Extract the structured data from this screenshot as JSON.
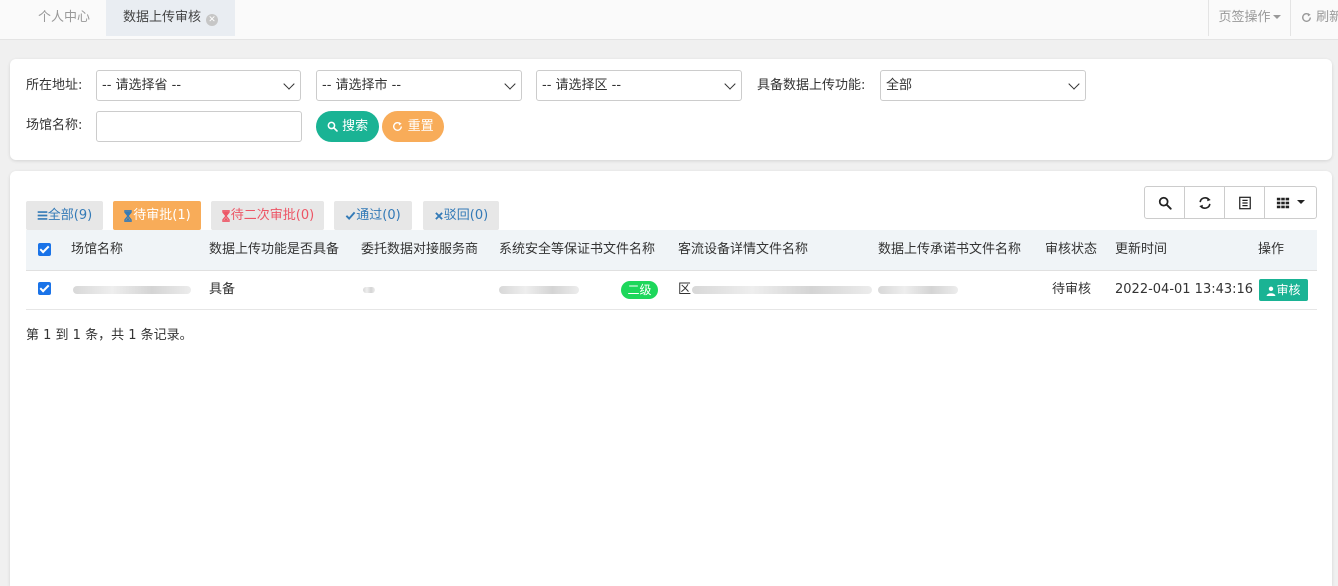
{
  "tabs": [
    {
      "label": "个人中心"
    },
    {
      "label": "数据上传审核",
      "close": "⊗"
    }
  ],
  "topbar": {
    "page_ops": "页签操作",
    "refresh": "刷新"
  },
  "search": {
    "address_label": "所在地址:",
    "province": "-- 请选择省 --",
    "city": "-- 请选择市 --",
    "district": "-- 请选择区 --",
    "upload_label": "具备数据上传功能:",
    "upload_value": "全部",
    "venue_label": "场馆名称:",
    "venue_value": "",
    "search_btn": "搜索",
    "reset_btn": "重置"
  },
  "status_tabs": [
    {
      "label": "全部(9)",
      "icon": "list-icon"
    },
    {
      "label": "待审批(1)",
      "icon": "hourglass-icon"
    },
    {
      "label": "待二次审批(0)",
      "icon": "hourglass-icon"
    },
    {
      "label": "通过(0)",
      "icon": "check-icon"
    },
    {
      "label": "驳回(0)",
      "icon": "x-icon"
    }
  ],
  "table": {
    "headers": [
      "场馆名称",
      "数据上传功能是否具备",
      "委托数据对接服务商",
      "系统安全等保证书文件名称",
      "客流设备详情文件名称",
      "数据上传承诺书文件名称",
      "审核状态",
      "更新时间",
      "操作"
    ],
    "rows": [
      {
        "venue": "[blurred]",
        "has_upload": "具备",
        "provider": "[blurred]",
        "cert_file": "[blurred]",
        "level": "二级",
        "device_file": "区[blurred]",
        "promise_file": "[blurred]",
        "status": "待审核",
        "updated": "2022-04-01 13:43:16",
        "action": "审核"
      }
    ]
  },
  "pagination": {
    "info": "第 1 到 1 条，共 1 条记录。"
  },
  "colors": {
    "primary": "#1ab394",
    "warning": "#f8ac59",
    "danger": "#ed5565",
    "link": "#337ab7",
    "level_badge": "#1dd75b"
  }
}
